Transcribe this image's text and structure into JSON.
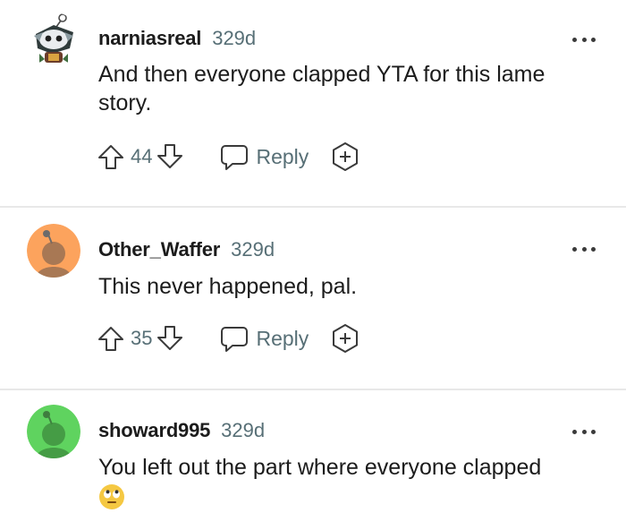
{
  "comments": [
    {
      "username": "narniasreal",
      "age": "329d",
      "text": "And then everyone clapped YTA for this lame story.",
      "score": "44",
      "reply_label": "Reply",
      "avatar_color": "#ffffff",
      "avatar_icon": "custom-snoo-avatar-icon"
    },
    {
      "username": "Other_Waffer",
      "age": "329d",
      "text": "This never happened, pal.",
      "score": "35",
      "reply_label": "Reply",
      "avatar_color": "#fca35d",
      "avatar_icon": "snoo-avatar-icon"
    },
    {
      "username": "showard995",
      "age": "329d",
      "text": "You left out the part where everyone clapped",
      "emoji": "eye-roll-emoji",
      "avatar_color": "#5fd35f",
      "avatar_icon": "snoo-avatar-icon"
    }
  ],
  "colors": {
    "meta_text": "#576f76",
    "body_text": "#1c1c1c",
    "divider": "#e8e8e8"
  }
}
